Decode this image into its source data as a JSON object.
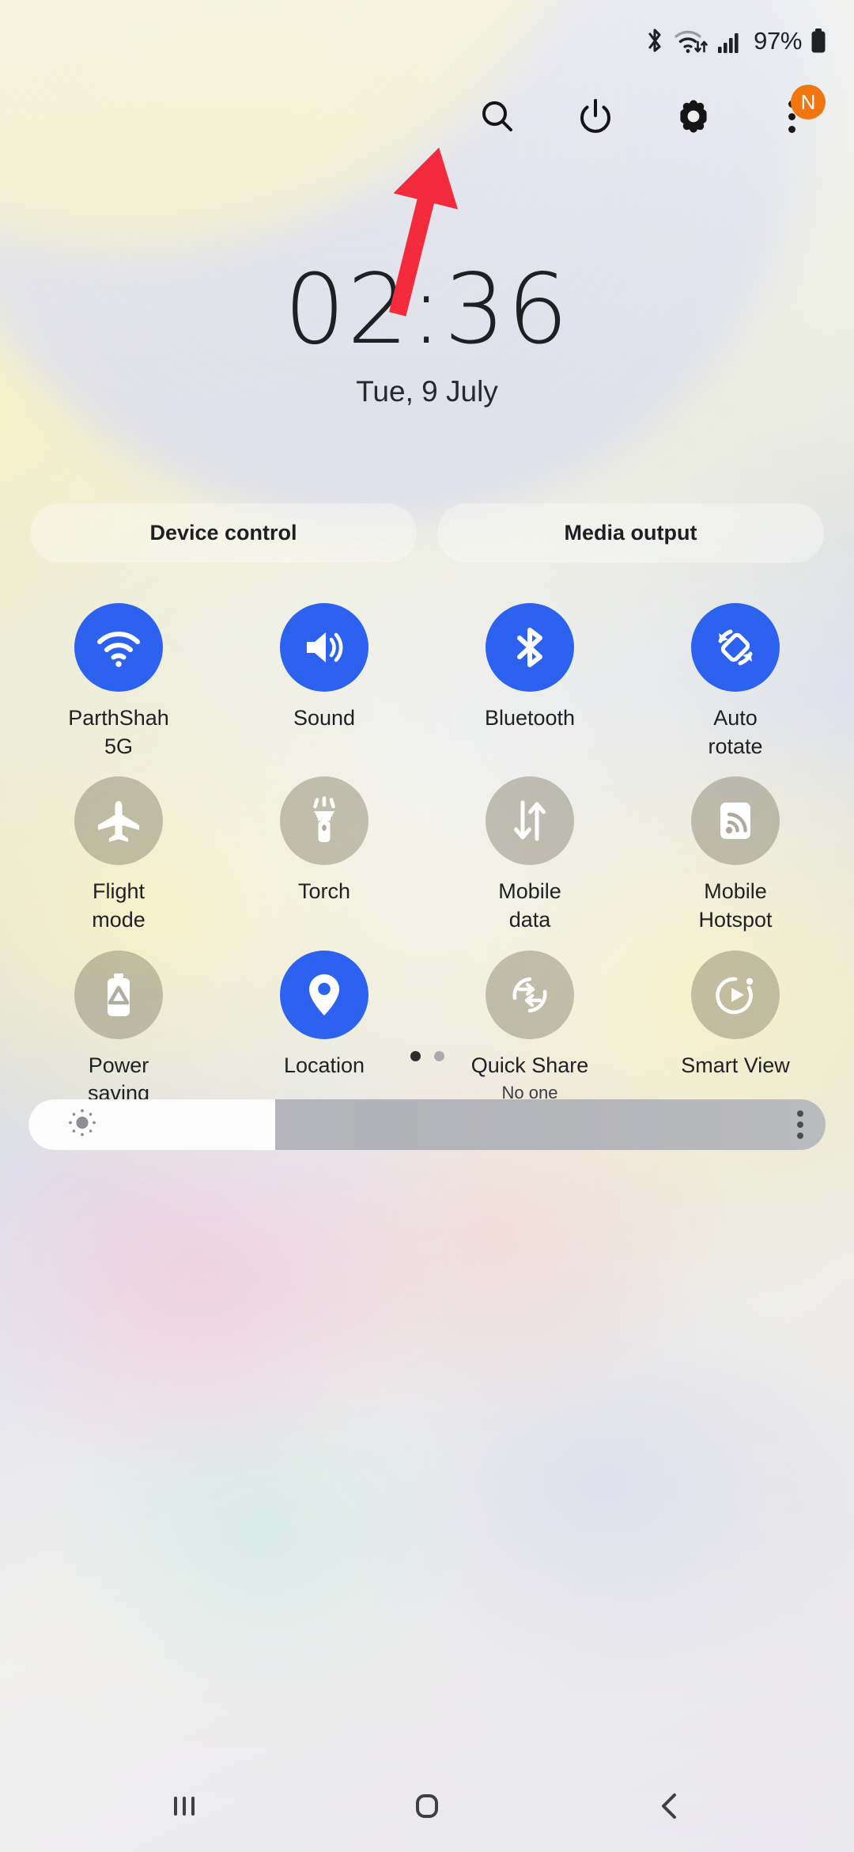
{
  "status_bar": {
    "bluetooth_icon": "bluetooth-icon",
    "wifi_icon": "wifi-data-icon",
    "signal_icon": "cellular-signal-icon",
    "battery_percent": "97%",
    "battery_icon": "battery-full-icon"
  },
  "toolbar": {
    "search_icon": "search-icon",
    "power_icon": "power-icon",
    "settings_icon": "gear-icon",
    "overflow_icon": "overflow-menu-icon",
    "new_badge": "N"
  },
  "clock": {
    "time": "02:36",
    "date": "Tue, 9 July"
  },
  "pills": [
    {
      "label": "Device control"
    },
    {
      "label": "Media output"
    }
  ],
  "quick_settings": {
    "tiles": [
      {
        "label": "ParthShah\n5G",
        "state": "on",
        "icon": "wifi-icon"
      },
      {
        "label": "Sound",
        "state": "on",
        "icon": "sound-icon"
      },
      {
        "label": "Bluetooth",
        "state": "on",
        "icon": "bluetooth-icon"
      },
      {
        "label": "Auto\nrotate",
        "state": "on",
        "icon": "auto-rotate-icon"
      },
      {
        "label": "Flight\nmode",
        "state": "off",
        "icon": "airplane-icon"
      },
      {
        "label": "Torch",
        "state": "off",
        "icon": "torch-icon"
      },
      {
        "label": "Mobile\ndata",
        "state": "off",
        "icon": "mobile-data-icon"
      },
      {
        "label": "Mobile\nHotspot",
        "state": "off",
        "icon": "hotspot-icon"
      },
      {
        "label": "Power\nsaving",
        "state": "off",
        "icon": "power-saving-icon"
      },
      {
        "label": "Location",
        "state": "on",
        "icon": "location-pin-icon"
      },
      {
        "label": "Quick Share",
        "state": "off",
        "icon": "quick-share-icon",
        "sublabel": "No one"
      },
      {
        "label": "Smart View",
        "state": "off",
        "icon": "smart-view-icon"
      }
    ]
  },
  "page_indicator": {
    "total": 2,
    "active": 1
  },
  "brightness": {
    "value_percent": 31,
    "icon": "brightness-sun-icon",
    "more_icon": "brightness-options-icon"
  },
  "nav_bar": {
    "recents_icon": "recents-icon",
    "home_icon": "home-icon",
    "back_icon": "back-icon"
  },
  "annotation": {
    "arrow": "red-arrow-pointing-to-power-button",
    "color": "#f42b3c"
  },
  "colors": {
    "accent_on": "#2c62ef",
    "tile_off": "rgba(122,116,96,0.42)",
    "badge": "#f2760f",
    "arrow": "#f42b3c"
  }
}
